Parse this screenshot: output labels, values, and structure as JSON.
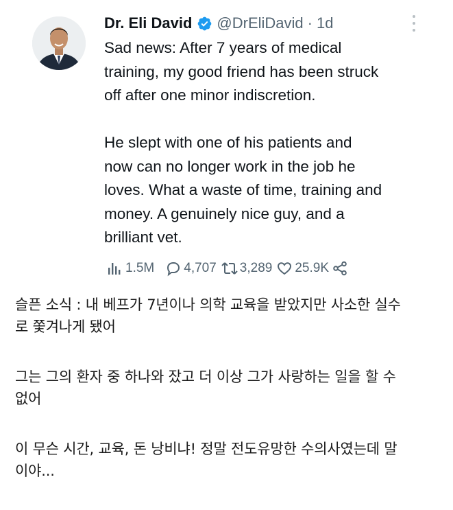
{
  "tweet": {
    "author_name": "Dr. Eli David",
    "handle": "@DrEliDavid",
    "separator": "·",
    "time": "1d",
    "text_lines": [
      "Sad news: After 7 years of medical",
      "training, my good friend has been struck",
      "off after one minor indiscretion.",
      "",
      "He slept with one of his patients and",
      "now can no longer work in the job he",
      "loves. What a waste of time, training and",
      "money. A genuinely nice guy, and a",
      "brilliant vet."
    ],
    "stats": {
      "views": "1.5M",
      "replies": "4,707",
      "retweets": "3,289",
      "likes": "25.9K"
    },
    "icons": [
      "avatar-photo",
      "verified-badge-icon",
      "more-options-icon",
      "views-icon",
      "reply-icon",
      "retweet-icon",
      "like-icon",
      "share-icon"
    ],
    "colors": {
      "verified": "#1d9bf0",
      "muted": "#536471",
      "text": "#0f1419"
    }
  },
  "translation": {
    "lines": [
      "슬픈 소식 : 내 베프가 7년이나 의학 교육을 받았지만 사소한 실수",
      "로 쫓겨나게 됐어",
      "그는 그의 환자 중 하나와 잤고 더 이상 그가 사랑하는 일을 할 수",
      "없어",
      "이 무슨 시간, 교육, 돈 낭비냐! 정말 전도유망한 수의사였는데 말",
      "이야..."
    ]
  }
}
